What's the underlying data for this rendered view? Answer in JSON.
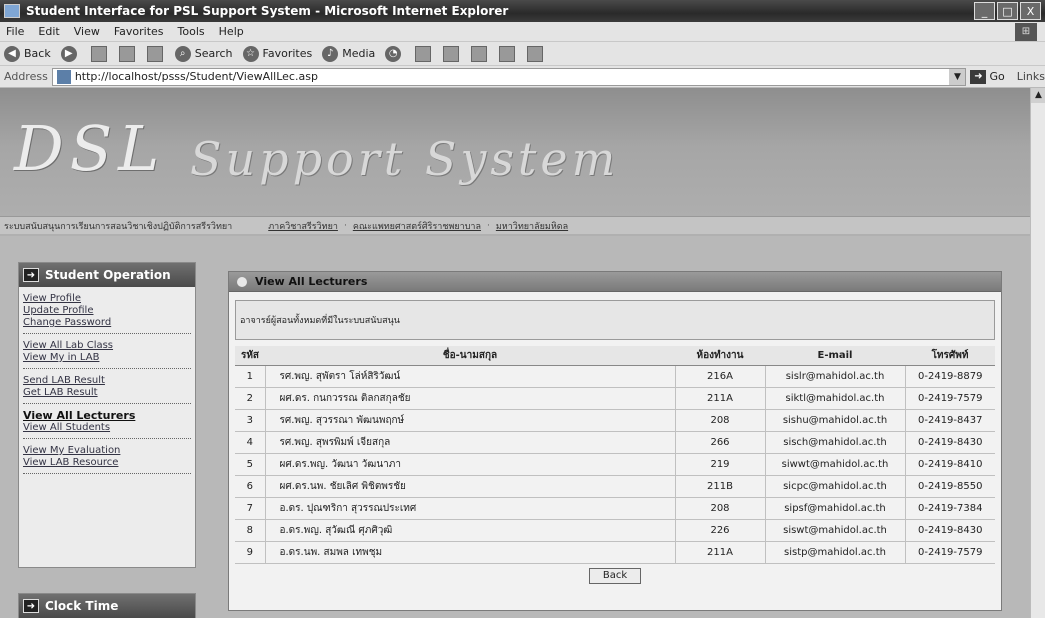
{
  "window": {
    "title": "Student Interface for PSL Support System - Microsoft Internet Explorer",
    "buttons": [
      "_",
      "□",
      "X"
    ]
  },
  "menubar": [
    "File",
    "Edit",
    "View",
    "Favorites",
    "Tools",
    "Help"
  ],
  "toolbar": {
    "back": "Back",
    "search": "Search",
    "favorites": "Favorites",
    "media": "Media"
  },
  "addressbar": {
    "label": "Address",
    "url": "http://localhost/psss/Student/ViewAllLec.asp",
    "go": "Go",
    "links": "Links"
  },
  "banner": {
    "logo": "DSL",
    "subtitle": "Support System"
  },
  "crumbs": {
    "site": "ระบบสนับสนุนการเรียนการสอนวิชาเชิงปฏิบัติการสรีรวิทยา",
    "items": [
      "ภาควิชาสรีรวิทยา",
      "คณะแพทยศาสตร์ศิริราชพยาบาล",
      "มหาวิทยาลัยมหิดล"
    ]
  },
  "sidebar": {
    "title": "Student Operation",
    "groups": [
      [
        "View Profile",
        "Update Profile",
        "Change Password"
      ],
      [
        "View All Lab Class",
        "View My in LAB"
      ],
      [
        "Send LAB Result",
        "Get LAB Result"
      ],
      [
        "View All Lecturers",
        "View All Students"
      ],
      [
        "View My Evaluation",
        "View LAB Resource"
      ]
    ],
    "active": "View All Lecturers"
  },
  "clock": {
    "title": "Clock Time"
  },
  "main": {
    "title": "View All Lecturers",
    "description": "อาจารย์ผู้สอนทั้งหมดที่มีในระบบสนับสนุน",
    "columns": [
      "รหัส",
      "ชื่อ-นามสกุล",
      "ห้องทำงาน",
      "E-mail",
      "โทรศัพท์"
    ],
    "rows": [
      [
        "1",
        "รศ.พญ. สุพัตรา โล่ห์สิริวัฒน์",
        "216A",
        "sislr@mahidol.ac.th",
        "0-2419-8879"
      ],
      [
        "2",
        "ผศ.ดร. กนกวรรณ ติลกสกุลชัย",
        "211A",
        "siktl@mahidol.ac.th",
        "0-2419-7579"
      ],
      [
        "3",
        "รศ.พญ. สุวรรณา พัฒนพฤกษ์",
        "208",
        "sishu@mahidol.ac.th",
        "0-2419-8437"
      ],
      [
        "4",
        "รศ.พญ. สุพรพิมพ์ เจียสกุล",
        "266",
        "sisch@mahidol.ac.th",
        "0-2419-8430"
      ],
      [
        "5",
        "ผศ.ดร.พญ. วัฒนา วัฒนาภา",
        "219",
        "siwwt@mahidol.ac.th",
        "0-2419-8410"
      ],
      [
        "6",
        "ผศ.ดร.นพ. ชัยเลิศ พิชิตพรชัย",
        "211B",
        "sicpc@mahidol.ac.th",
        "0-2419-8550"
      ],
      [
        "7",
        "อ.ดร. ปุณฑริกา สุวรรณประเทศ",
        "208",
        "sipsf@mahidol.ac.th",
        "0-2419-7384"
      ],
      [
        "8",
        "อ.ดร.พญ. สุวัฒณี ศุภศิวุฒิ",
        "226",
        "siswt@mahidol.ac.th",
        "0-2419-8430"
      ],
      [
        "9",
        "อ.ดร.นพ. สมพล เทพชุม",
        "211A",
        "sistp@mahidol.ac.th",
        "0-2419-7579"
      ]
    ],
    "back": "Back"
  }
}
